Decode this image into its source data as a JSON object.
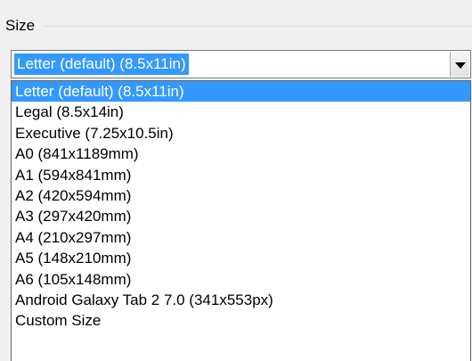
{
  "group": {
    "label": "Size"
  },
  "combo": {
    "selected_value": "Letter (default) (8.5x11in)"
  },
  "dropdown": {
    "items": [
      "Letter (default) (8.5x11in)",
      "Legal (8.5x14in)",
      "Executive (7.25x10.5in)",
      "A0 (841x1189mm)",
      "A1 (594x841mm)",
      "A2 (420x594mm)",
      "A3 (297x420mm)",
      "A4 (210x297mm)",
      "A5 (148x210mm)",
      "A6 (105x148mm)",
      "Android Galaxy Tab 2 7.0 (341x553px)",
      "Custom Size"
    ],
    "highlighted_index": 0
  },
  "colors": {
    "selection": "#3399ff",
    "background": "#f0f0f0"
  },
  "icons": {
    "dropdown_arrow": "chevron-down-icon"
  }
}
